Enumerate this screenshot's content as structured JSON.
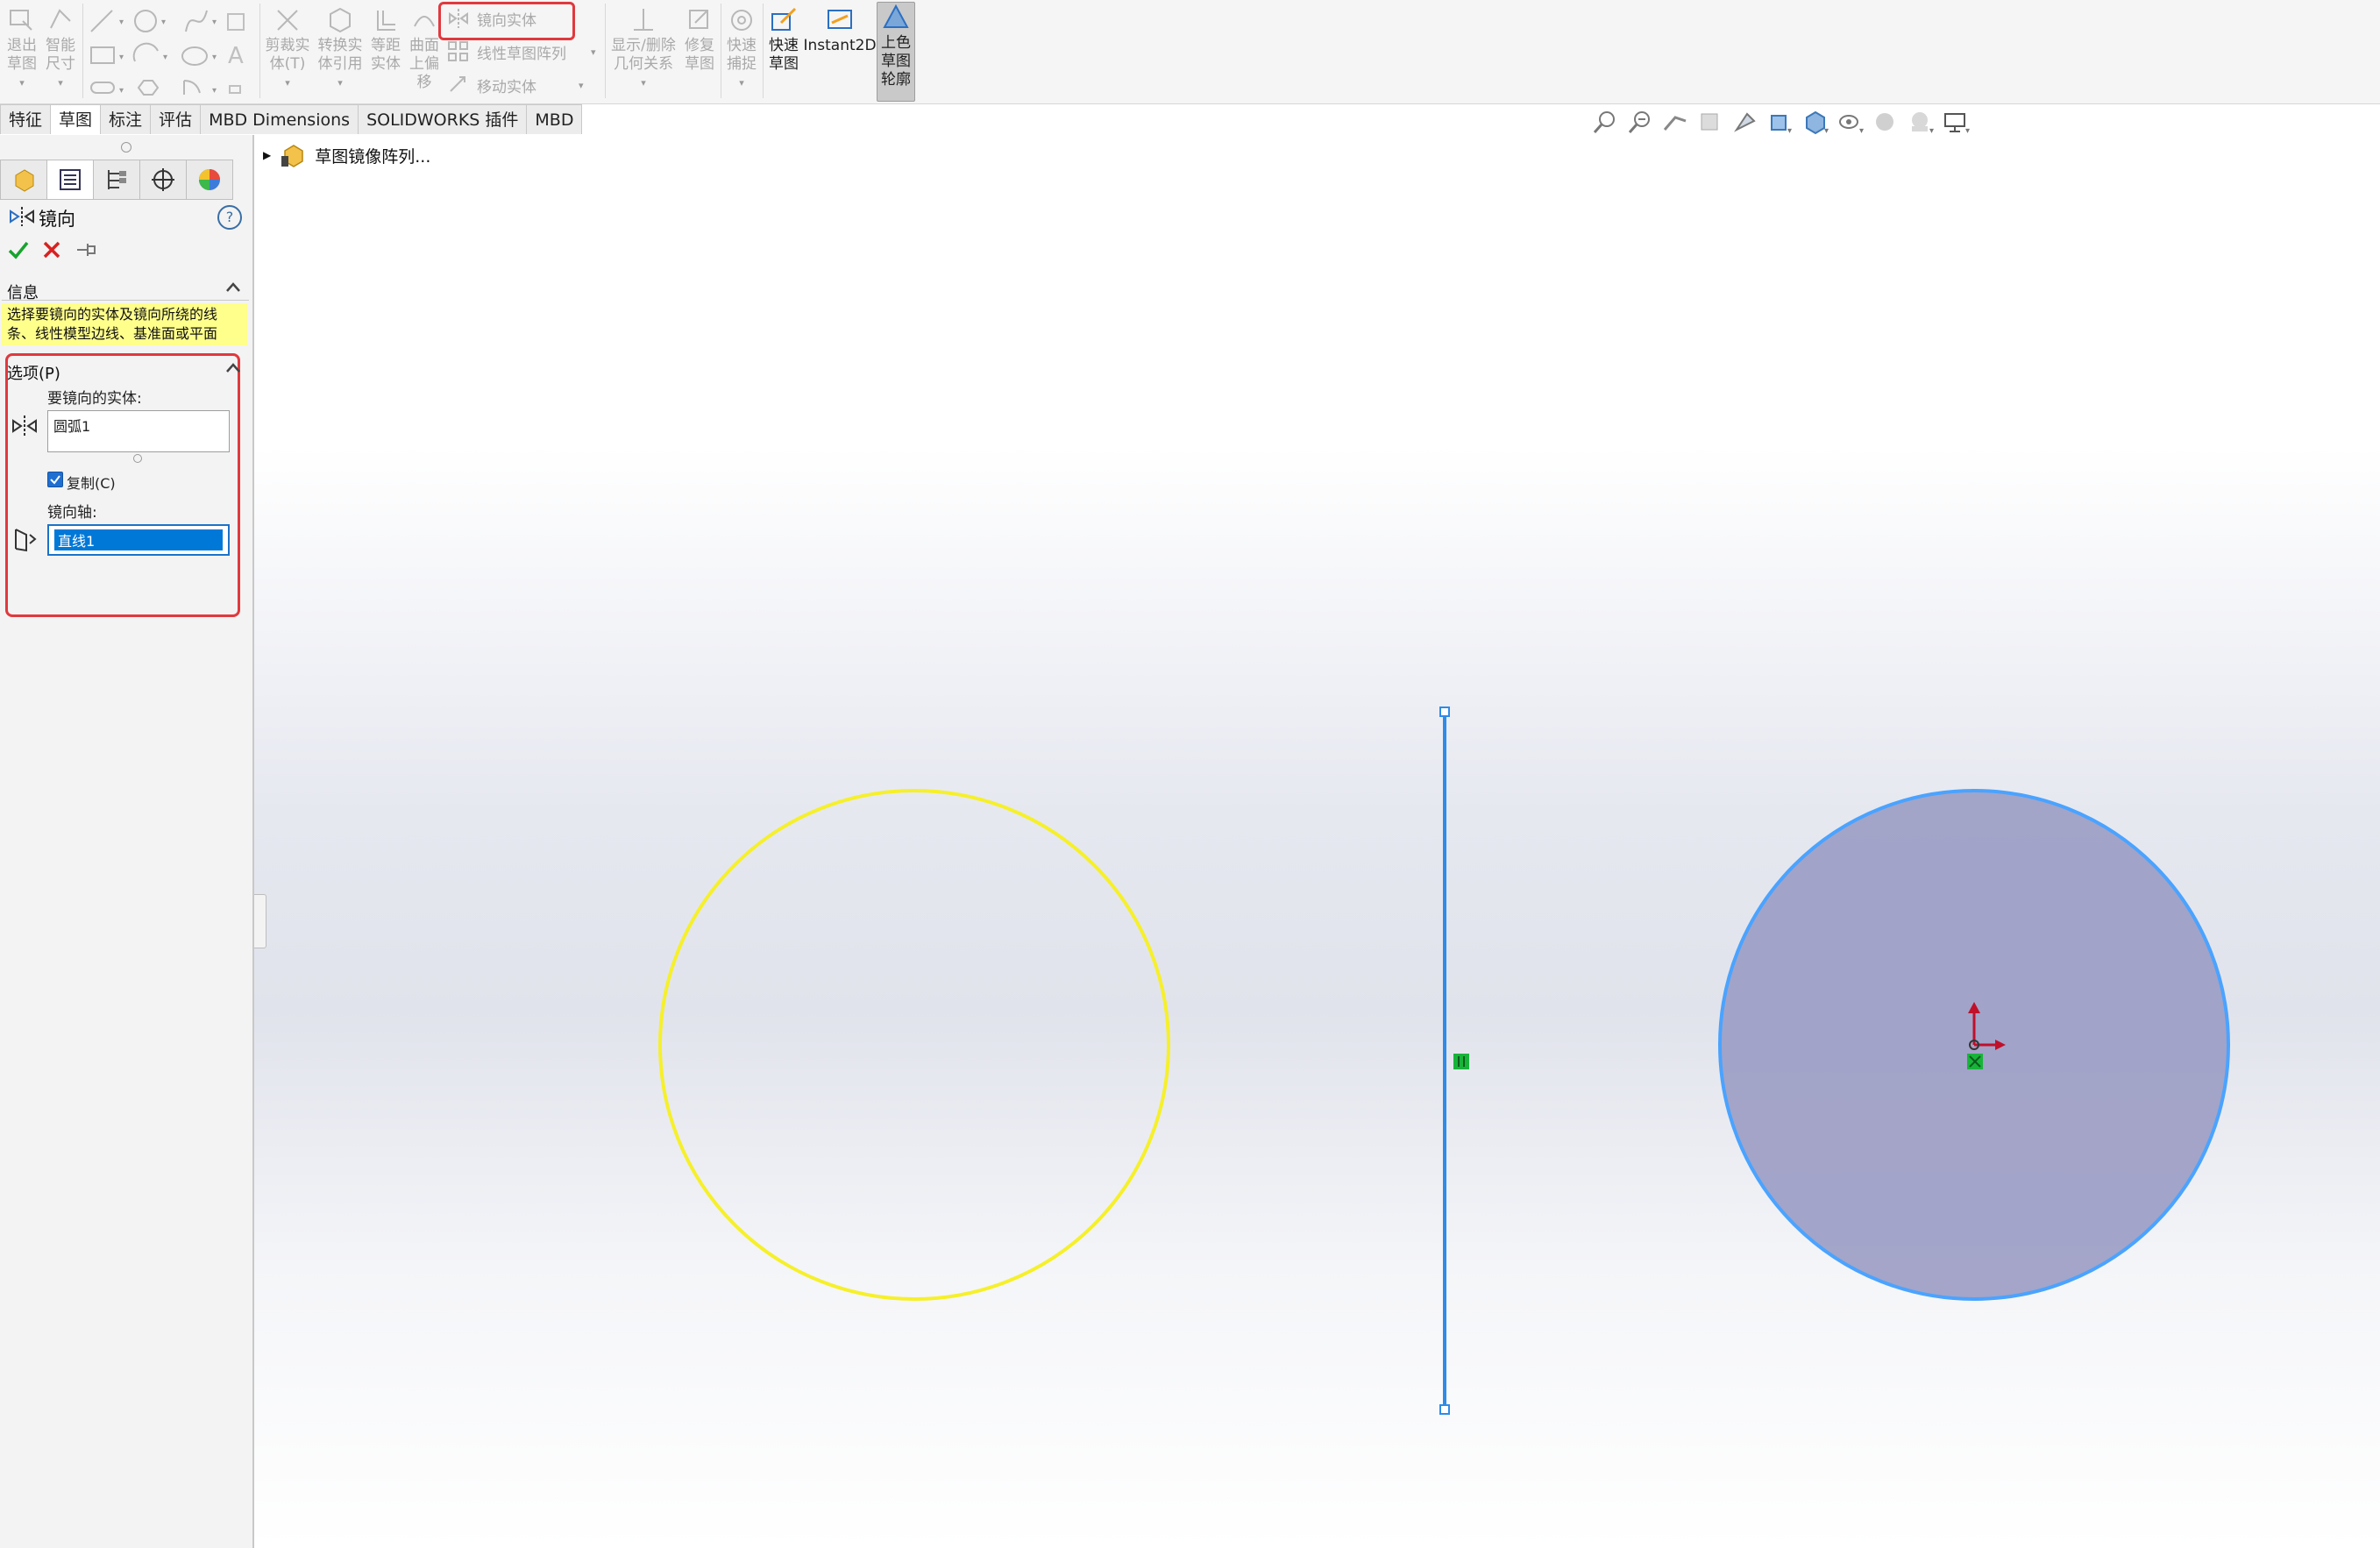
{
  "ribbon": {
    "exit_sketch": [
      "退出",
      "草图"
    ],
    "smart_dim": [
      "智能",
      "尺寸"
    ],
    "trim": [
      "剪裁实",
      "体(T)"
    ],
    "convert": [
      "转换实",
      "体引用"
    ],
    "offset": [
      "等距",
      "实体"
    ],
    "surface_offset": [
      "曲面",
      "上偏",
      "移"
    ],
    "mirror_entities": "镜向实体",
    "linear_pattern": "线性草图阵列",
    "move_entities": "移动实体",
    "show_relations": [
      "显示/删除",
      "几何关系"
    ],
    "repair": [
      "修复",
      "草图"
    ],
    "quick_snap": [
      "快速",
      "捕捉"
    ],
    "rapid_sketch": [
      "快速",
      "草图"
    ],
    "instant2d": "Instant2D",
    "shaded_contours": [
      "上色",
      "草图",
      "轮廓"
    ]
  },
  "tabs": [
    "特征",
    "草图",
    "标注",
    "评估",
    "MBD Dimensions",
    "SOLIDWORKS 插件",
    "MBD"
  ],
  "active_tab": "草图",
  "panel": {
    "title": "镜向",
    "help": "?",
    "info_header": "信息",
    "info_text": "选择要镜向的实体及镜向所绕的线条、线性模型边线、基准面或平面",
    "options_header": "选项(P)",
    "entities_label": "要镜向的实体:",
    "entities_value": "圆弧1",
    "copy_label": "复制(C)",
    "copy_checked": true,
    "axis_label": "镜向轴:",
    "axis_value": "直线1"
  },
  "tree": {
    "item": "草图镜像阵列..."
  },
  "colors": {
    "selected_circle": "#f6f02a",
    "line": "#2f8be8",
    "fill_circle": "#9c9dc4",
    "highlight": "#e0393e",
    "info_bg": "#ffff8c"
  }
}
